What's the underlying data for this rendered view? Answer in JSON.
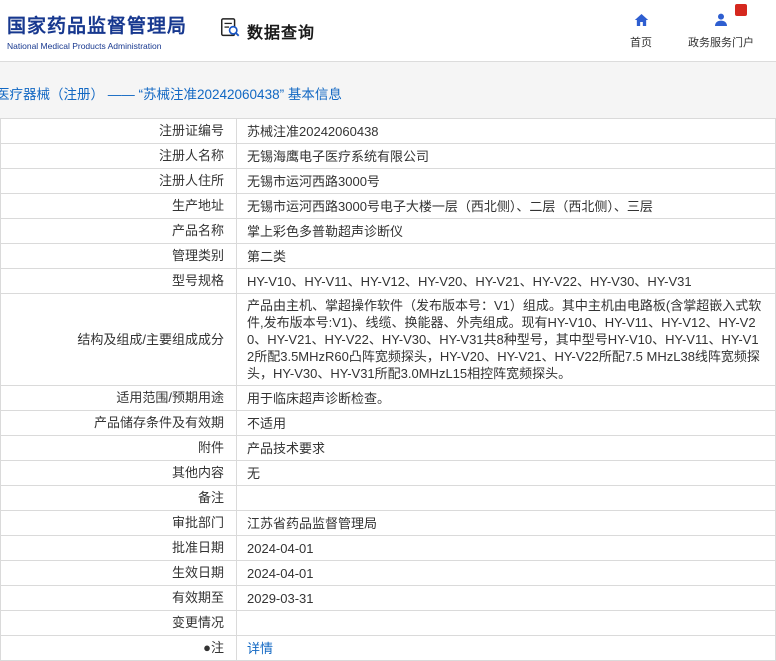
{
  "header": {
    "logo_cn": "国家药品监督管理局",
    "logo_en": "National Medical Products Administration",
    "section_title": "数据查询",
    "nav": {
      "home": "首页",
      "portal": "政务服务门户"
    }
  },
  "page": {
    "title": "医疗器械（注册） —— “苏械注准20242060438” 基本信息"
  },
  "table": {
    "rows": [
      {
        "label": "注册证编号",
        "value": "苏械注准20242060438"
      },
      {
        "label": "注册人名称",
        "value": "无锡海鹰电子医疗系统有限公司"
      },
      {
        "label": "注册人住所",
        "value": "无锡市运河西路3000号"
      },
      {
        "label": "生产地址",
        "value": "无锡市运河西路3000号电子大楼一层（西北侧）、二层（西北侧）、三层"
      },
      {
        "label": "产品名称",
        "value": "掌上彩色多普勒超声诊断仪"
      },
      {
        "label": "管理类别",
        "value": "第二类"
      },
      {
        "label": "型号规格",
        "value": "HY-V10、HY-V11、HY-V12、HY-V20、HY-V21、HY-V22、HY-V30、HY-V31"
      },
      {
        "label": "结构及组成/主要组成成分",
        "value": "产品由主机、掌超操作软件（发布版本号：V1）组成。其中主机由电路板(含掌超嵌入式软件,发布版本号:V1)、线缆、换能器、外壳组成。现有HY-V10、HY-V11、HY-V12、HY-V20、HY-V21、HY-V22、HY-V30、HY-V31共8种型号，其中型号HY-V10、HY-V11、HY-V12所配3.5MHzR60凸阵宽频探头，HY-V20、HY-V21、HY-V22所配7.5 MHzL38线阵宽频探头，HY-V30、HY-V31所配3.0MHzL15相控阵宽频探头。"
      },
      {
        "label": "适用范围/预期用途",
        "value": "用于临床超声诊断检查。"
      },
      {
        "label": "产品储存条件及有效期",
        "value": "不适用"
      },
      {
        "label": "附件",
        "value": "产品技术要求"
      },
      {
        "label": "其他内容",
        "value": "无"
      },
      {
        "label": "备注",
        "value": ""
      },
      {
        "label": "审批部门",
        "value": "江苏省药品监督管理局"
      },
      {
        "label": "批准日期",
        "value": "2024-04-01"
      },
      {
        "label": "生效日期",
        "value": "2024-04-01"
      },
      {
        "label": "有效期至",
        "value": "2029-03-31"
      },
      {
        "label": "变更情况",
        "value": ""
      },
      {
        "label": "●注",
        "value": "详情",
        "link": true
      }
    ]
  },
  "colors": {
    "brand_blue": "#17388f",
    "link_blue": "#1268c3",
    "icon_blue": "#2e5ed0",
    "badge_red": "#d5281e",
    "border_gray": "#dadada"
  }
}
